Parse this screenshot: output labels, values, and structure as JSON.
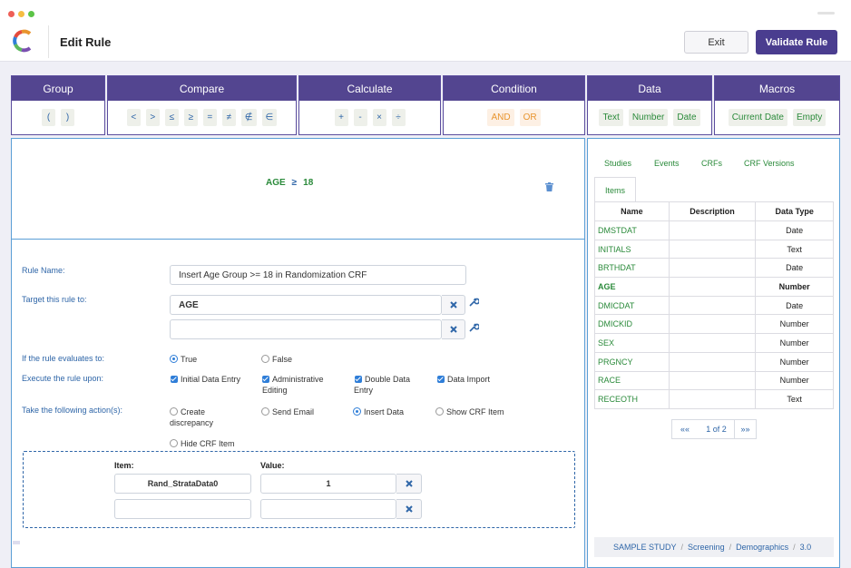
{
  "header": {
    "title": "Edit Rule",
    "exit_label": "Exit",
    "validate_label": "Validate Rule"
  },
  "palette": [
    {
      "title": "Group",
      "items": [
        "(",
        ")"
      ]
    },
    {
      "title": "Compare",
      "items": [
        "<",
        ">",
        "≤",
        "≥",
        "=",
        "≠",
        "∉",
        "∈"
      ]
    },
    {
      "title": "Calculate",
      "items": [
        "+",
        "-",
        "×",
        "÷"
      ]
    },
    {
      "title": "Condition",
      "items": [
        "AND",
        "OR"
      ]
    },
    {
      "title": "Data",
      "items": [
        "Text",
        "Number",
        "Date"
      ]
    },
    {
      "title": "Macros",
      "items": [
        "Current Date",
        "Empty"
      ]
    }
  ],
  "expression": {
    "left": "AGE",
    "op": "≥",
    "right": "18"
  },
  "form": {
    "rule_name_label": "Rule Name:",
    "rule_name_value": "Insert Age Group >= 18 in Randomization CRF",
    "target_label": "Target this rule to:",
    "target_value": "AGE",
    "target_value2": "",
    "evaluates_label": "If the rule evaluates to:",
    "eval_true": "True",
    "eval_false": "False",
    "execute_label": "Execute the rule upon:",
    "exec_initial": "Initial Data Entry",
    "exec_admin_1": "Administrative",
    "exec_admin_2": "Editing",
    "exec_double_1": "Double Data",
    "exec_double_2": "Entry",
    "exec_import": "Data Import",
    "actions_label": "Take the following action(s):",
    "act_create_1": "Create",
    "act_create_2": "discrepancy",
    "act_email": "Send Email",
    "act_insert": "Insert Data",
    "act_show": "Show CRF Item",
    "act_hide": "Hide CRF Item",
    "item_header": "Item:",
    "value_header": "Value:",
    "item1": "Rand_StrataData0",
    "value1": "1",
    "item2": "",
    "value2": ""
  },
  "data_panel": {
    "tabs": [
      "Studies",
      "Events",
      "CRFs",
      "CRF Versions"
    ],
    "active_tab": "Items",
    "columns": [
      "Name",
      "Description",
      "Data Type"
    ],
    "rows": [
      {
        "name": "DMSTDAT",
        "type": "Date"
      },
      {
        "name": "INITIALS",
        "type": "Text"
      },
      {
        "name": "BRTHDAT",
        "type": "Date"
      },
      {
        "name": "AGE",
        "type": "Number"
      },
      {
        "name": "DMICDAT",
        "type": "Date"
      },
      {
        "name": "DMICKID",
        "type": "Number"
      },
      {
        "name": "SEX",
        "type": "Number"
      },
      {
        "name": "PRGNCY",
        "type": "Number"
      },
      {
        "name": "RACE",
        "type": "Number"
      },
      {
        "name": "RECEOTH",
        "type": "Text"
      }
    ],
    "pager": {
      "prev": "««",
      "page": "1 of 2",
      "next": "»»"
    },
    "breadcrumb": [
      "SAMPLE STUDY",
      "Screening",
      "Demographics",
      "3.0"
    ]
  },
  "colors": {
    "brand": "#534590",
    "accent": "#2f66a8",
    "green": "#2a8a3a",
    "orange": "#e8942e"
  }
}
